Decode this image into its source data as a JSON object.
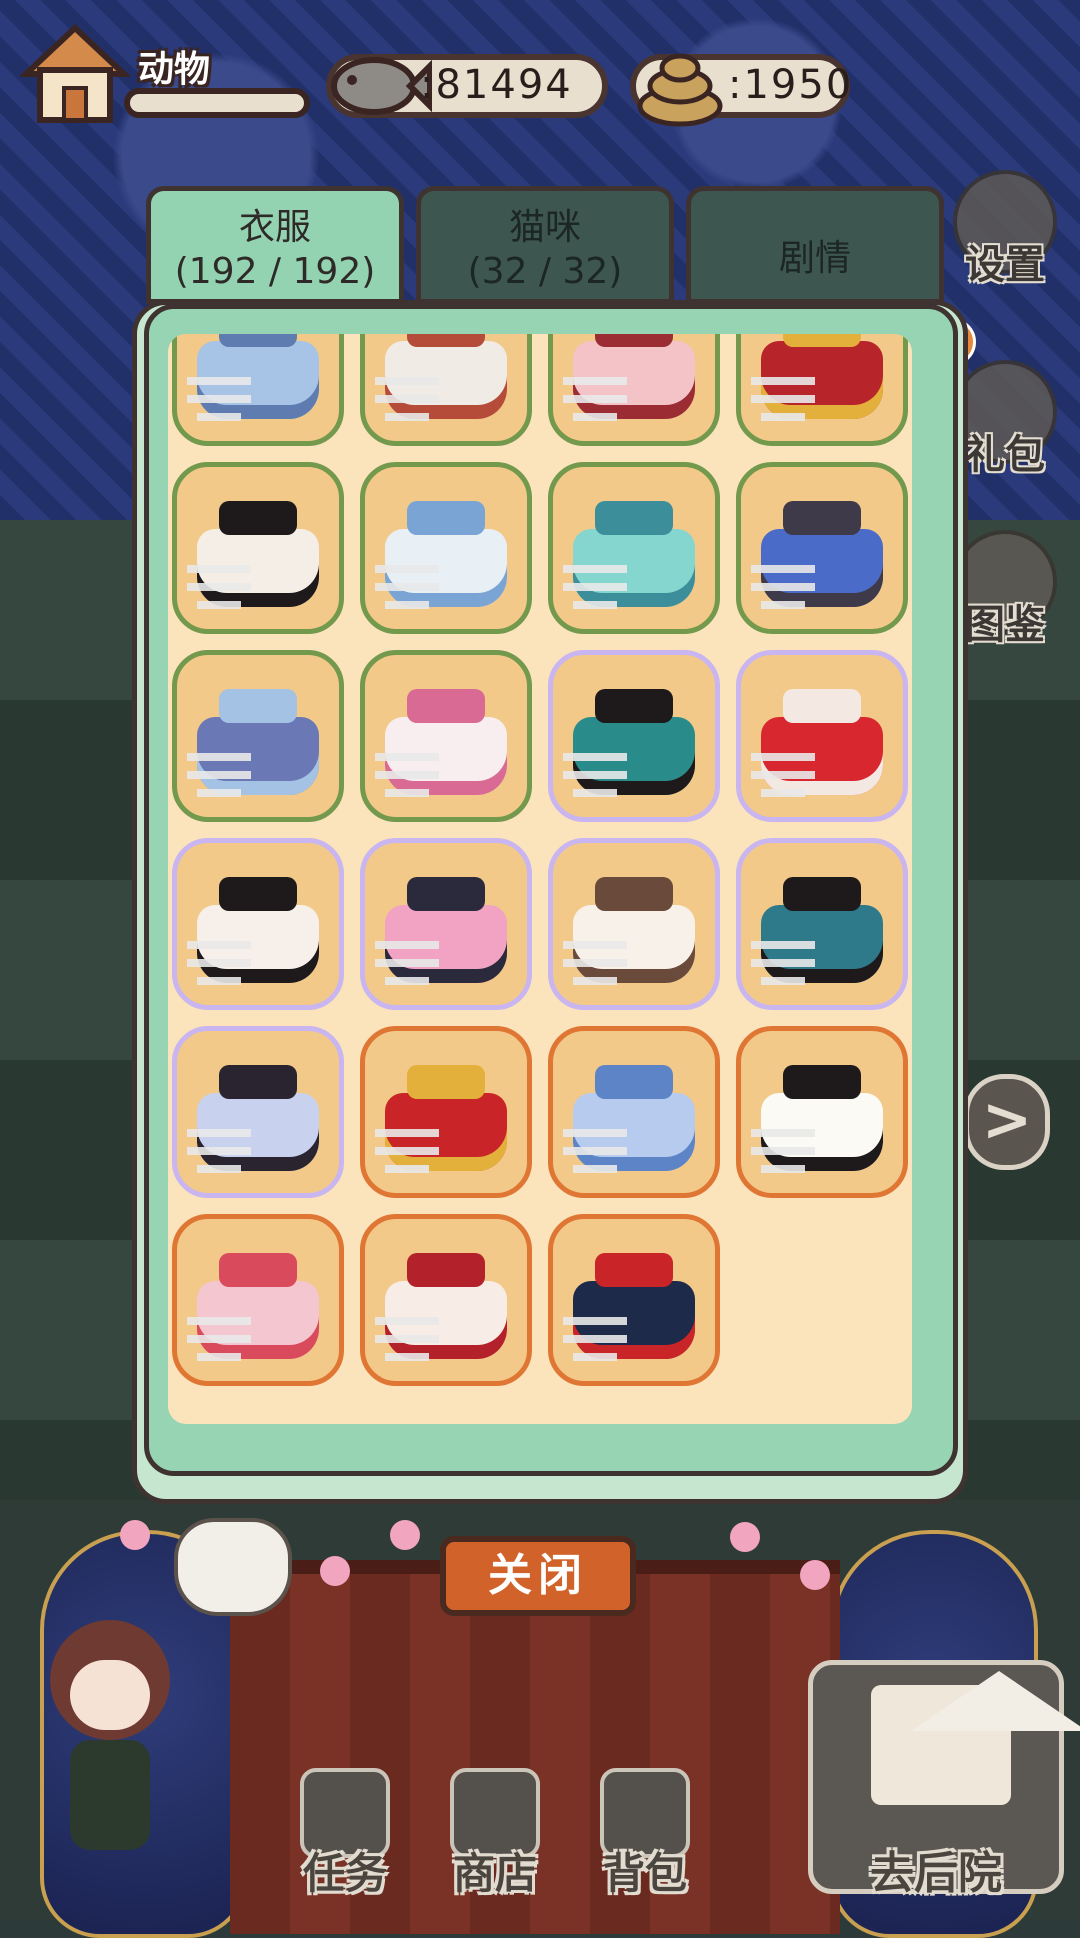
{
  "hud": {
    "animal_label": "动物",
    "animal_progress": 0.0,
    "fish_count": ":81494",
    "poop_count": ":1950"
  },
  "side_buttons": [
    {
      "label": "设置",
      "icon": "gear-icon"
    },
    {
      "label": "礼包",
      "icon": "gift-icon"
    },
    {
      "label": "图鉴",
      "icon": "book-icon"
    }
  ],
  "help_badge": "?",
  "next_symbol": ">",
  "tabs": [
    {
      "name": "衣服",
      "count": "(192 / 192)",
      "active": true
    },
    {
      "name": "猫咪",
      "count": "(32 / 32)",
      "active": false
    },
    {
      "name": "剧情",
      "count": "",
      "active": false
    }
  ],
  "items": [
    {
      "rarity": "green",
      "main": "#a7c4e6",
      "accent": "#5e7cb0"
    },
    {
      "rarity": "green",
      "main": "#f1ebe6",
      "accent": "#b54c3a"
    },
    {
      "rarity": "green",
      "main": "#f3c3c7",
      "accent": "#9b2c33"
    },
    {
      "rarity": "green",
      "main": "#b7242a",
      "accent": "#e3b03b"
    },
    {
      "rarity": "green",
      "main": "#f5eee6",
      "accent": "#1e1a1c"
    },
    {
      "rarity": "green",
      "main": "#e8f0f6",
      "accent": "#7aa4d4"
    },
    {
      "rarity": "green",
      "main": "#86d6d0",
      "accent": "#3c8f9a"
    },
    {
      "rarity": "green",
      "main": "#4a6cc8",
      "accent": "#3e3a4a"
    },
    {
      "rarity": "green",
      "main": "#6a78b6",
      "accent": "#a4c2e4"
    },
    {
      "rarity": "green",
      "main": "#f8eef0",
      "accent": "#d86a94"
    },
    {
      "rarity": "purple",
      "main": "#2a8c8a",
      "accent": "#1e1a1c"
    },
    {
      "rarity": "purple",
      "main": "#d8272f",
      "accent": "#f4e9e2"
    },
    {
      "rarity": "purple",
      "main": "#f7f0ea",
      "accent": "#1e1a1c"
    },
    {
      "rarity": "purple",
      "main": "#f2a3c4",
      "accent": "#2b2a3c"
    },
    {
      "rarity": "purple",
      "main": "#f7f1ea",
      "accent": "#6a4a3a"
    },
    {
      "rarity": "purple",
      "main": "#2f7a8a",
      "accent": "#1e1a1c"
    },
    {
      "rarity": "purple",
      "main": "#c8d2ee",
      "accent": "#2a2430"
    },
    {
      "rarity": "orange",
      "main": "#c92427",
      "accent": "#e3b03b"
    },
    {
      "rarity": "orange",
      "main": "#b7cbee",
      "accent": "#5e84c8"
    },
    {
      "rarity": "orange",
      "main": "#fbfaf5",
      "accent": "#1e1a1c"
    },
    {
      "rarity": "orange",
      "main": "#f4c6cf",
      "accent": "#d84a5c"
    },
    {
      "rarity": "orange",
      "main": "#f7ece6",
      "accent": "#b3222a"
    },
    {
      "rarity": "orange",
      "main": "#1e2a4a",
      "accent": "#c92427"
    }
  ],
  "close_label": "关闭",
  "nav": [
    {
      "label": "任务",
      "icon": "task-icon"
    },
    {
      "label": "商店",
      "icon": "shop-icon"
    },
    {
      "label": "背包",
      "icon": "backpack-icon"
    }
  ],
  "backyard_label": "去后院",
  "colors": {
    "panel_green": "#94d3b2",
    "panel_cream": "#fbe3bc",
    "rarity_green": "#72994c",
    "rarity_purple": "#c9b5f0",
    "rarity_orange": "#df7634",
    "close_orange": "#d0622a"
  }
}
